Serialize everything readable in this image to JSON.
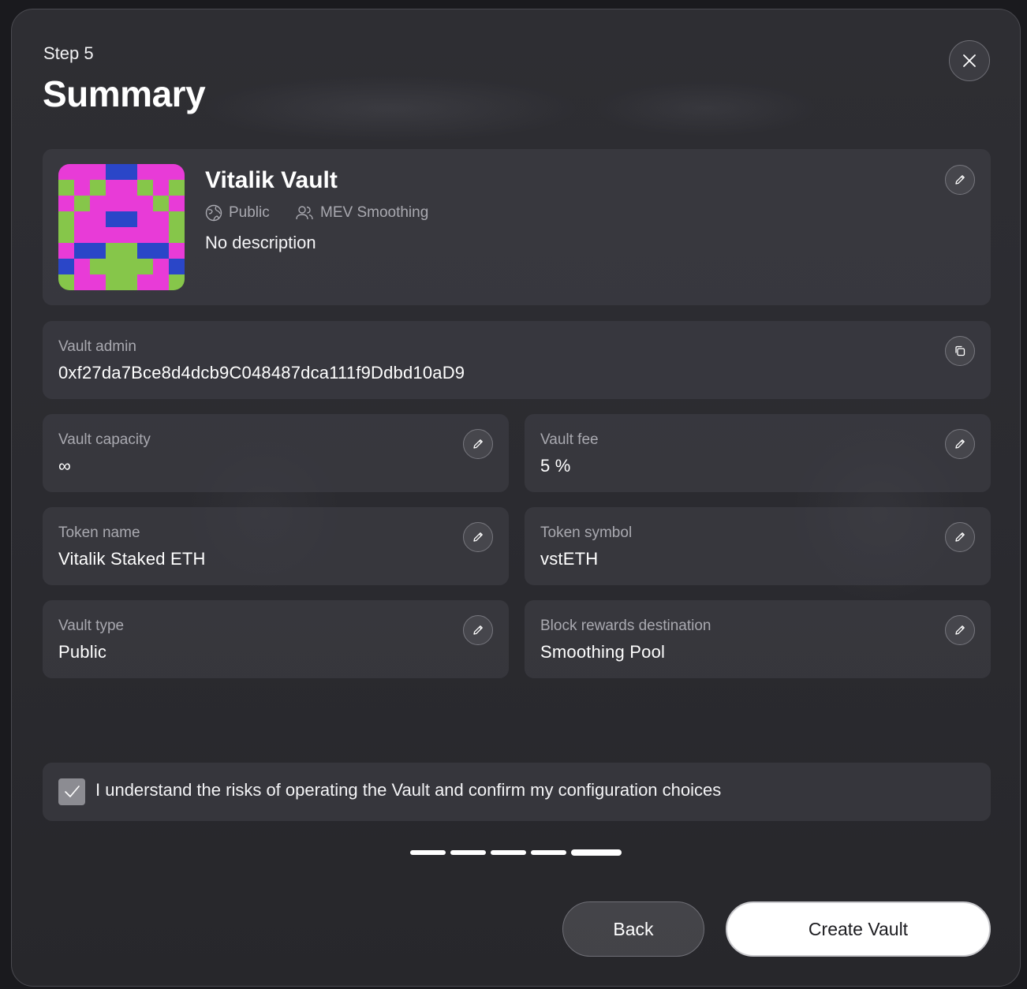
{
  "header": {
    "step_label": "Step 5",
    "title": "Summary"
  },
  "vault": {
    "name": "Vitalik Vault",
    "visibility": "Public",
    "mev_mode": "MEV Smoothing",
    "description": "No description",
    "avatar_colors": {
      "magenta": "#e83bd7",
      "green": "#86c64a",
      "blue": "#2a46c8"
    }
  },
  "fields": {
    "admin": {
      "label": "Vault admin",
      "value": "0xf27da7Bce8d4dcb9C048487dca111f9Ddbd10aD9"
    },
    "capacity": {
      "label": "Vault capacity",
      "value": "∞"
    },
    "fee": {
      "label": "Vault fee",
      "value": "5 %"
    },
    "token_name": {
      "label": "Token name",
      "value": "Vitalik Staked ETH"
    },
    "token_symbol": {
      "label": "Token symbol",
      "value": "vstETH"
    },
    "vault_type": {
      "label": "Vault type",
      "value": "Public"
    },
    "rewards": {
      "label": "Block rewards destination",
      "value": "Smoothing Pool"
    }
  },
  "confirm": {
    "text": "I understand the risks of operating the Vault and confirm my configuration choices",
    "checked": true
  },
  "progress": {
    "current_step": 5,
    "total_steps": 5
  },
  "actions": {
    "back_label": "Back",
    "create_label": "Create Vault"
  },
  "icons": {
    "close": "close-icon",
    "edit": "pencil-icon",
    "copy": "copy-icon",
    "globe": "globe-icon",
    "users": "users-icon",
    "check": "check-icon"
  }
}
